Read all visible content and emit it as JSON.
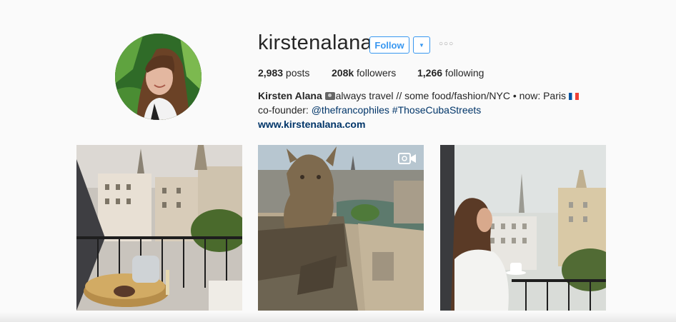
{
  "profile": {
    "username": "kirstenalana",
    "follow_label": "Follow",
    "dropdown_icon": "caret-down-icon",
    "more_icon": "ellipsis-icon",
    "avatar": "profile-photo"
  },
  "stats": {
    "posts_count": "2,983",
    "posts_label": " posts",
    "followers_count": "208k",
    "followers_label": " followers",
    "following_count": "1,266",
    "following_label": " following"
  },
  "bio": {
    "name": "Kirsten Alana",
    "camera_icon": "camera-emoji-icon",
    "text1": "always travel // some food/fashion/NYC • now: Paris",
    "flag_icon": "french-flag-icon",
    "text2": "co-founder: ",
    "mention": "@thefrancophiles",
    "hashtag": "#ThoseCubaStreets",
    "website": "www.kirstenalana.com"
  },
  "posts": [
    {
      "kind": "photo",
      "subject": "paris-balcony-champagne"
    },
    {
      "kind": "video",
      "subject": "notre-dame-gargoyle",
      "badge_icon": "video-camera-icon"
    },
    {
      "kind": "photo",
      "subject": "woman-coffee-eiffel-view"
    }
  ],
  "colors": {
    "accent": "#3897f0",
    "link": "#003569",
    "background": "#fafafa",
    "text": "#262626"
  }
}
